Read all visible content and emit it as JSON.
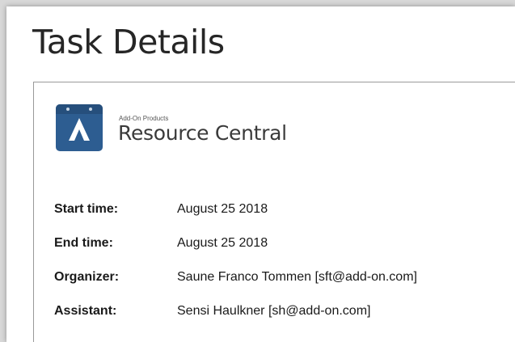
{
  "page": {
    "title": "Task Details"
  },
  "brand": {
    "small": "Add-On Products",
    "name": "Resource Central",
    "logo_icon": "resource-central-logo-icon",
    "logo_color": "#2d5d91"
  },
  "details": [
    {
      "label": "Start time:",
      "value": "August 25 2018"
    },
    {
      "label": "End time:",
      "value": "August 25 2018"
    },
    {
      "label": "Organizer:",
      "value": "Saune Franco Tommen [sft@add-on.com]"
    },
    {
      "label": "Assistant:",
      "value": "Sensi Haulkner [sh@add-on.com]"
    }
  ]
}
